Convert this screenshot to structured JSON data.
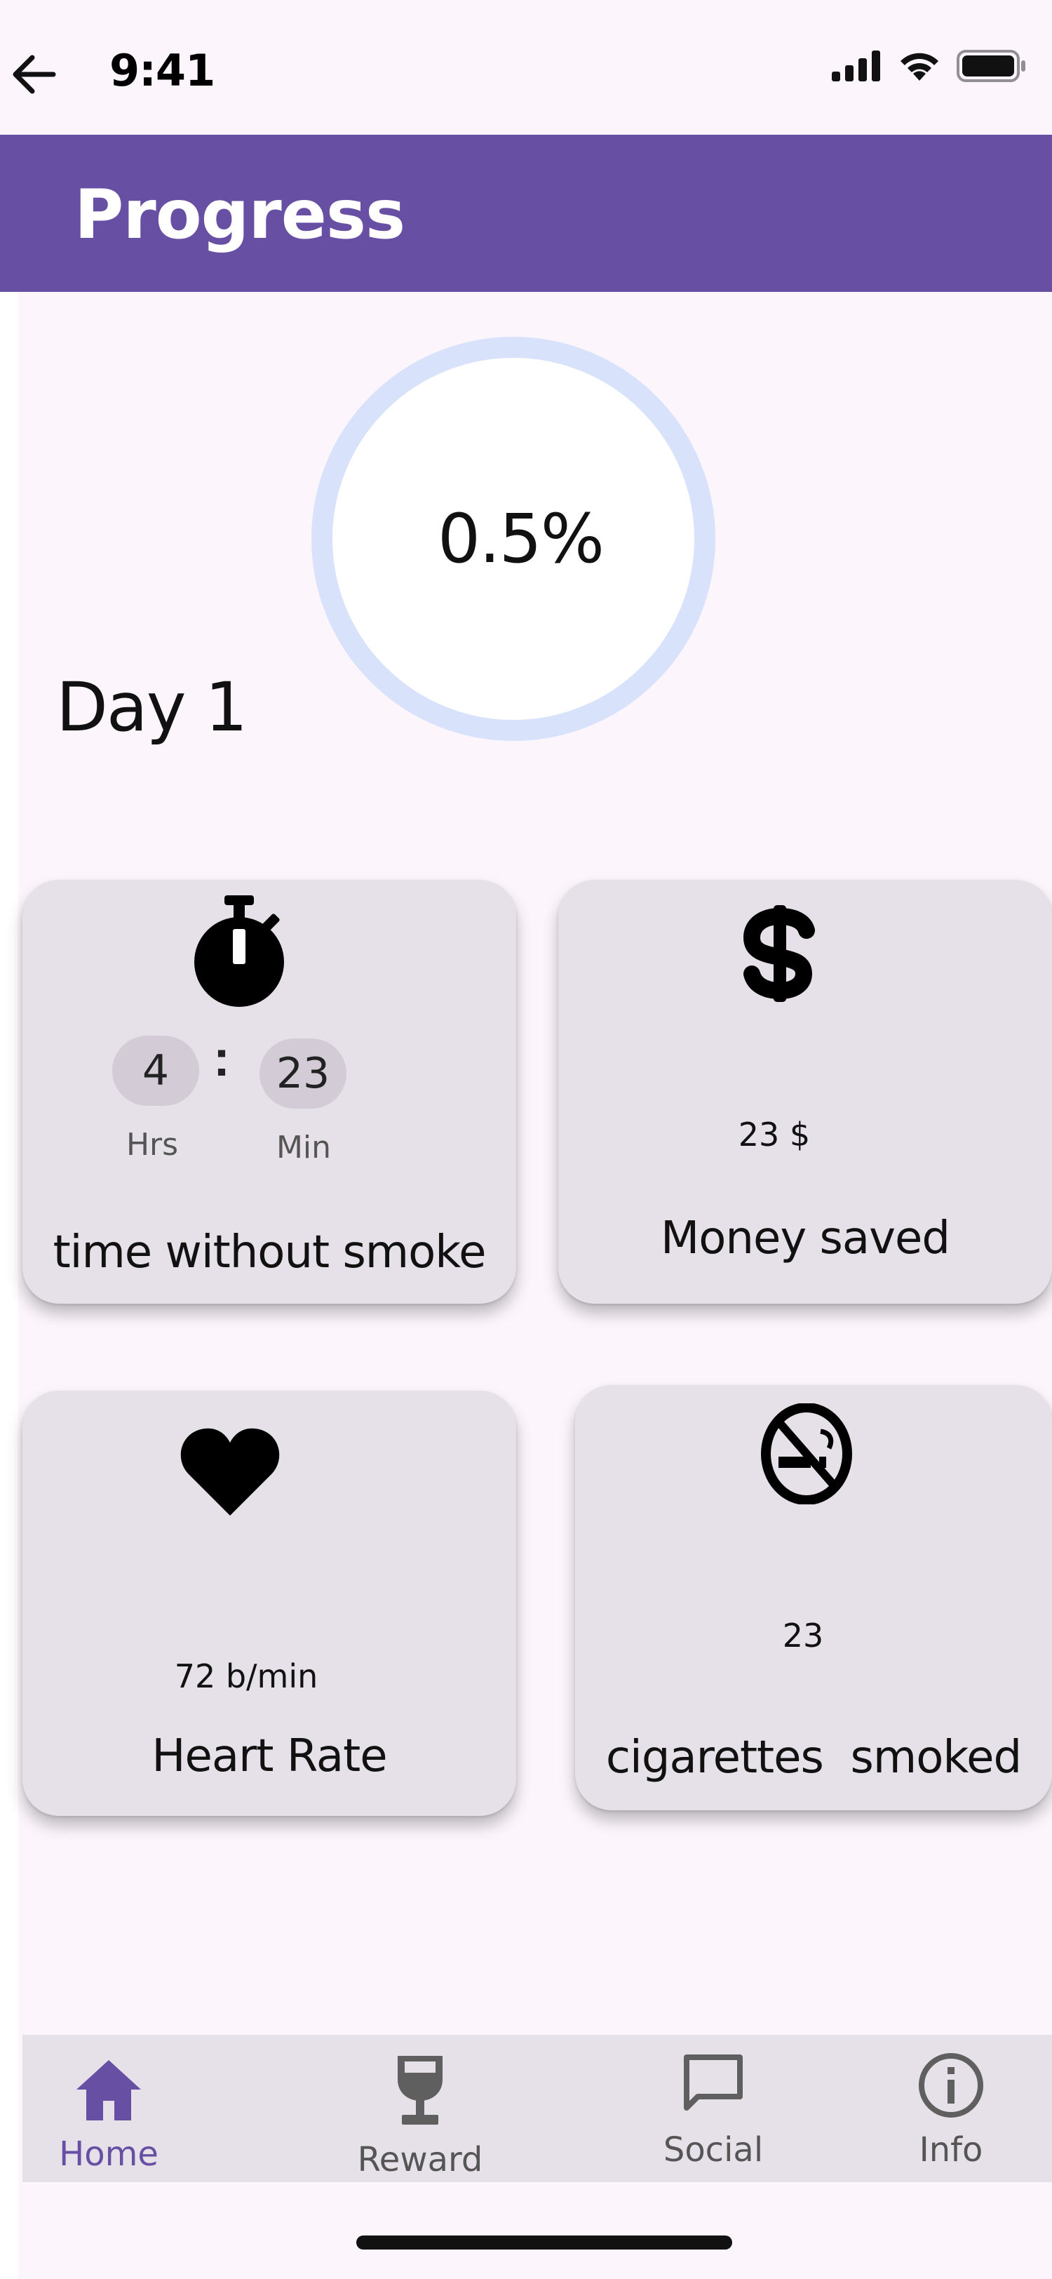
{
  "status_bar": {
    "time": "9:41"
  },
  "app_bar": {
    "title": "Progress"
  },
  "progress": {
    "percent_label": "0.5%",
    "percent_value": 0.5,
    "day_label": "Day 1"
  },
  "cards": {
    "time_without_smoke": {
      "hours": "4",
      "hours_unit": "Hrs",
      "minutes": "23",
      "minutes_unit": "Min",
      "separator": ":",
      "label": "time without smoke",
      "icon": "stopwatch-icon"
    },
    "money_saved": {
      "value": "23 $",
      "label": "Money saved",
      "icon": "dollar-icon"
    },
    "heart_rate": {
      "value": "72 b/min",
      "label": "Heart Rate",
      "icon": "heart-icon"
    },
    "cigarettes_smoked": {
      "value": "23",
      "label": "cigarettes  smoked",
      "icon": "no-smoking-icon"
    }
  },
  "bottom_nav": {
    "items": [
      {
        "label": "Home",
        "icon": "home-icon",
        "active": true
      },
      {
        "label": "Reward",
        "icon": "trophy-icon",
        "active": false
      },
      {
        "label": "Social",
        "icon": "chat-icon",
        "active": false
      },
      {
        "label": "Info",
        "icon": "info-icon",
        "active": false
      }
    ]
  },
  "colors": {
    "primary": "#6750a4",
    "background": "#fcf6fc",
    "card": "#e6e0e8",
    "ring": "#d8e2fb"
  }
}
